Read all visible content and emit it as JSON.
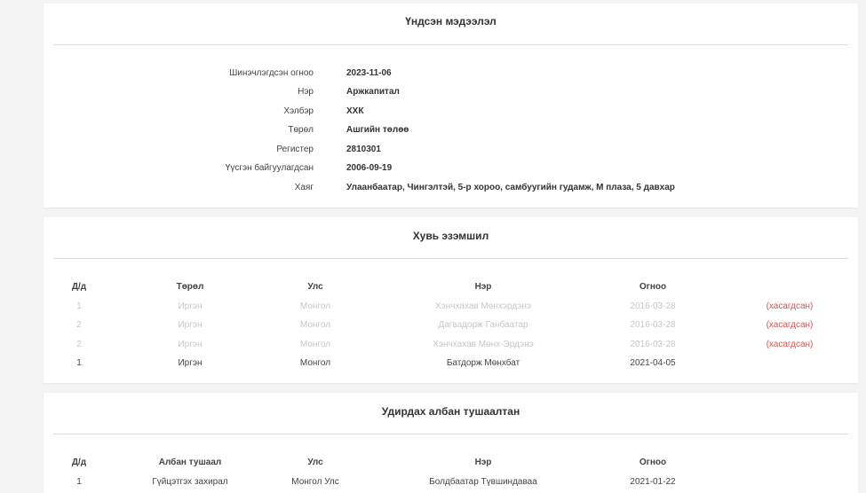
{
  "basic_info": {
    "title": "Үндсэн мэдээлэл",
    "rows": [
      {
        "label": "Шинэчлэгдсэн огноо",
        "value": "2023-11-06"
      },
      {
        "label": "Нэр",
        "value": "Аржкапитал"
      },
      {
        "label": "Хэлбэр",
        "value": "ХХК"
      },
      {
        "label": "Төрөл",
        "value": "Ашгийн төлөө"
      },
      {
        "label": "Регистер",
        "value": "2810301"
      },
      {
        "label": "Үүсгэн байгуулагдсан",
        "value": "2006-09-19"
      },
      {
        "label": "Хаяг",
        "value": "Улаанбаатар, Чингэлтэй, 5-р хороо, самбуугийн гудамж, М плаза, 5 давхар"
      }
    ]
  },
  "ownership": {
    "title": "Хувь эзэмшил",
    "headers": {
      "no": "Д/д",
      "type": "Төрөл",
      "country": "Улс",
      "name": "Нэр",
      "date": "Огноо"
    },
    "rows": [
      {
        "no": "1",
        "type": "Иргэн",
        "country": "Монгол",
        "name": "Хэнчхахав Мөнхэрдэнэ",
        "date": "2016-03-28",
        "note": "(хасагдсан)",
        "removed": true
      },
      {
        "no": "2",
        "type": "Иргэн",
        "country": "Монгол",
        "name": "Дагвадорж Ганбаатар",
        "date": "2016-03-28",
        "note": "(хасагдсан)",
        "removed": true
      },
      {
        "no": "2",
        "type": "Иргэн",
        "country": "Монгол",
        "name": "Хэнчхахав Мөнх-Эрдэнэ",
        "date": "2016-03-28",
        "note": "(хасагдсан)",
        "removed": true
      },
      {
        "no": "1",
        "type": "Иргэн",
        "country": "Монгол",
        "name": "Батдорж Мөнхбат",
        "date": "2021-04-05",
        "note": "",
        "removed": false
      }
    ]
  },
  "officials": {
    "title": "Удирдах албан тушаалтан",
    "headers": {
      "no": "Д/д",
      "position": "Албан тушаал",
      "country": "Улс",
      "name": "Нэр",
      "date": "Огноо"
    },
    "rows": [
      {
        "no": "1",
        "position": "Гүйцэтгэх захирал",
        "country": "Монгол Улс",
        "name": "Болдбаатар Түвшиндаваа",
        "date": "2021-01-22"
      }
    ]
  },
  "colors": {
    "removed_note": "#d9534f",
    "faded_text": "#c7c7c7"
  }
}
